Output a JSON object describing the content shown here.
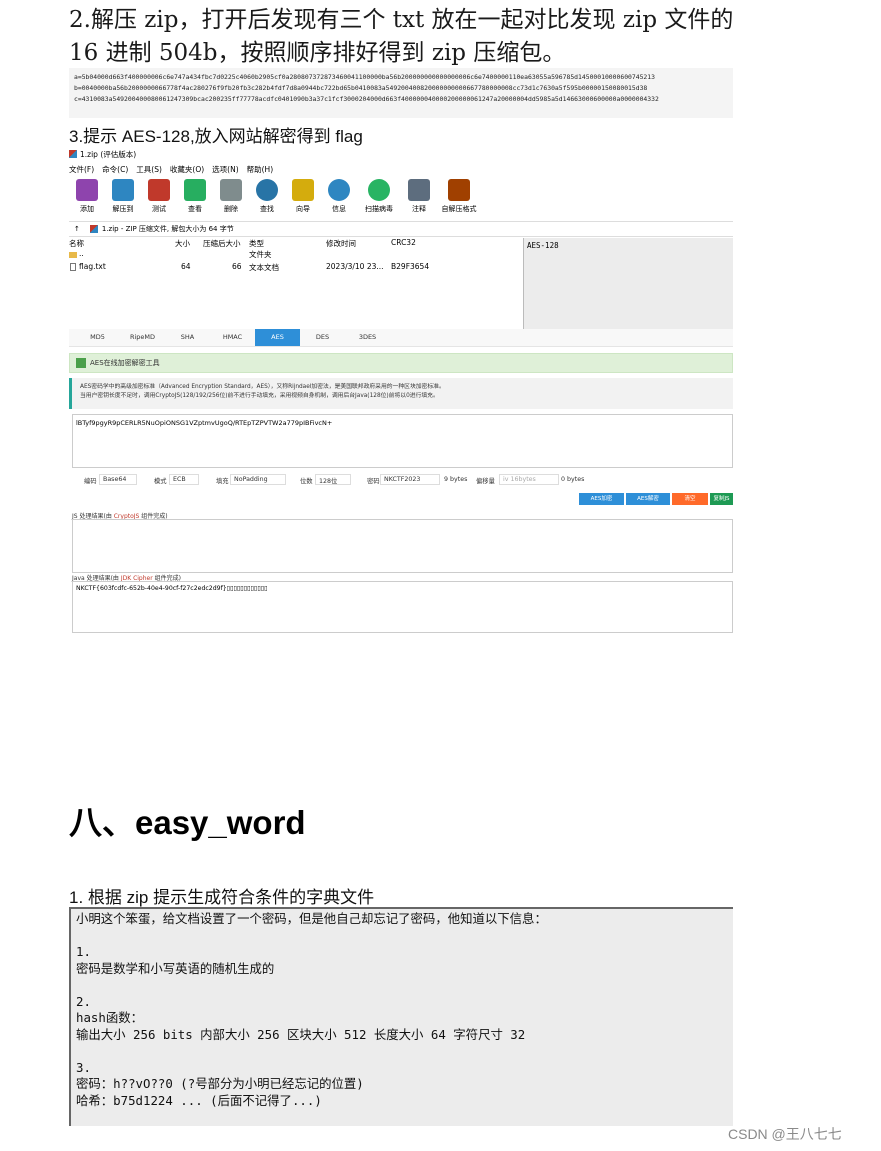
{
  "step2": {
    "line1": "2.解压 zip，打开后发现有三个 txt 放在一起对比发现 zip 文件的",
    "line2": "16 进制 504b，按照顺序排好得到 zip 压缩包。"
  },
  "hex": {
    "a": "a=5b04000d663f400000006c6e747a434fbc7d0225c4060b2905cf0a280807372873460041100000ba56b200000000000000006c6e7400000110ea63055a596785d14500010000600745213",
    "b": "b=0040000ba56b2000000066778f4ac280276f9fb20fb3c282b4fdf7d8a0944bc722bd65b0410083a549200400820000000000667780000008cc73d1c7630a5f595b00000150080015d38",
    "c": "c=4310083a549200400080061247309bcac200235ff77778acdfc0401090b3a37c1fcf3000204000d663f400000040000200000061247a20000004dd5985a5d14663000600000a0000004332"
  },
  "step3": "3.提示 AES-128,放入网站解密得到 flag",
  "rar": {
    "title": "1.zip (评估版本)",
    "menu": [
      "文件(F)",
      "命令(C)",
      "工具(S)",
      "收藏夹(O)",
      "选项(N)",
      "帮助(H)"
    ],
    "tools": [
      {
        "label": "添加",
        "icon": "add-icon",
        "color": "#8e44ad"
      },
      {
        "label": "解压到",
        "icon": "extract-icon",
        "color": "#2e86c1"
      },
      {
        "label": "测试",
        "icon": "test-icon",
        "color": "#c0392b"
      },
      {
        "label": "查看",
        "icon": "view-icon",
        "color": "#27ae60"
      },
      {
        "label": "删除",
        "icon": "delete-icon",
        "color": "#7f8c8d"
      },
      {
        "label": "查找",
        "icon": "find-icon",
        "color": "#2874a6"
      },
      {
        "label": "向导",
        "icon": "wizard-icon",
        "color": "#d4ac0d"
      },
      {
        "label": "信息",
        "icon": "info-icon",
        "color": "#2e86c1"
      },
      {
        "label": "扫描病毒",
        "icon": "scan-icon",
        "color": "#28b463"
      },
      {
        "label": "注释",
        "icon": "comment-icon",
        "color": "#5d6d7e"
      },
      {
        "label": "自解压格式",
        "icon": "sfx-icon",
        "color": "#a04000"
      }
    ],
    "address": "1.zip - ZIP 压缩文件, 解包大小为 64 字节",
    "columns": [
      "名称",
      "大小",
      "压缩后大小",
      "类型",
      "修改时间",
      "CRC32"
    ],
    "rows": [
      {
        "name": "..",
        "size": "",
        "packed": "",
        "type": "文件夹",
        "modified": "",
        "crc": ""
      },
      {
        "name": "flag.txt",
        "size": "64",
        "packed": "66",
        "type": "文本文档",
        "modified": "2023/3/10 23...",
        "crc": "B29F3654"
      }
    ],
    "comment": "AES-128"
  },
  "aes_tool": {
    "tabs": [
      "MD5",
      "RipeMD",
      "SHA",
      "HMAC",
      "AES",
      "DES",
      "3DES"
    ],
    "active_tab": "AES",
    "header": "AES在线加密解密工具",
    "info_line1": "AES密码学中的高级加密标准（Advanced Encryption Standard，AES），又称Rijndael加密法，是美国联邦政府采用的一种区块加密标准。",
    "info_line2": "当用户密钥长度不足时，调用CryptoJS(128/192/256位)前不进行手动填充，采用视频自身机制，调用后台Java(128位)前将以0进行填充。",
    "ciphertext": "lBTyf9pgyR9pCERLR5NuOpiONSG1VZptmvUgoQ/RTEpTZPVTW2a779pIBFivcN+",
    "encoding_label": "编码",
    "encoding": "Base64",
    "mode_label": "模式",
    "mode": "ECB",
    "padding_label": "填充",
    "padding": "NoPadding",
    "bits_label": "位数",
    "bits": "128位",
    "key_label": "密码",
    "key": "NKCTF2023",
    "key_bytes": "9 bytes",
    "iv_label": "偏移量",
    "iv_placeholder": "iv 16bytes",
    "iv_bytes": "0 bytes",
    "buttons": [
      "AES加密",
      "AES解密",
      "清空",
      "复制JS"
    ],
    "js_result_prefix": "JS 处理结果(由 ",
    "js_result_link": "CryptoJS",
    "js_result_suffix": " 组件完成)",
    "java_result_prefix": "Java 处理结果(由 ",
    "java_result_link": "JDK Cipher",
    "java_result_suffix": " 组件完成)",
    "java_output": "NKCTF{603fcdfc-652b-40e4-90cf-f27c2edc2d9f}▯▯▯▯▯▯▯▯▯▯▯▯"
  },
  "section8": "八、easy_word",
  "step1": "1. 根据 zip 提示生成符合条件的字典文件",
  "note": [
    "小明这个笨蛋，给文档设置了一个密码，但是他自己却忘记了密码，他知道以下信息：",
    "",
    "1.",
    "密码是数学和小写英语的随机生成的",
    "",
    "2.",
    "hash函数：",
    "输出大小 256 bits 内部大小 256 区块大小 512 长度大小 64 字符尺寸 32",
    "",
    "3.",
    "密码：h??vO??0 (?号部分为小明已经忘记的位置)",
    "哈希：b75d1224 ... (后面不记得了...)"
  ],
  "watermark": "CSDN @王八七七",
  "colors": {
    "aes_blue": "#2e8fd8",
    "green": "#dff0d8",
    "teal": "#26a69a",
    "btn_blue": "#2e8fd8",
    "btn_orange": "#ff6a2a",
    "btn_green": "#1e9a54"
  }
}
